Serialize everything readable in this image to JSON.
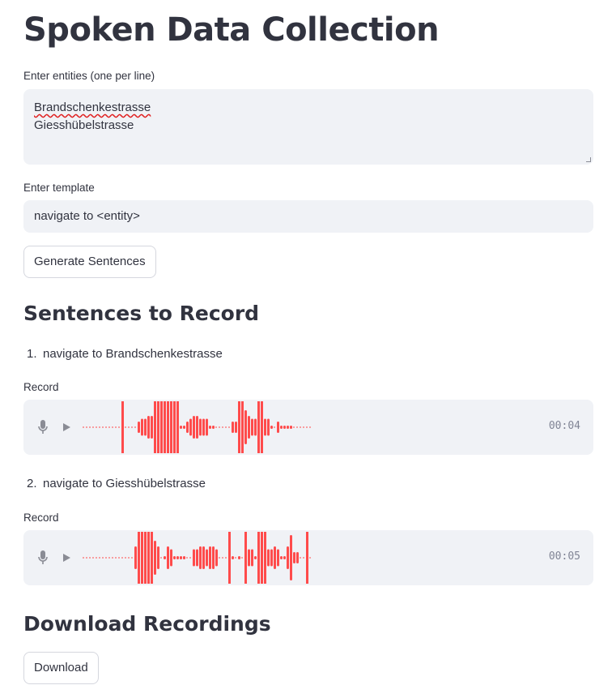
{
  "page": {
    "title": "Spoken Data Collection"
  },
  "entities": {
    "label": "Enter entities (one per line)",
    "lines": [
      "Brandschenkestrasse",
      "Giesshübelstrasse"
    ]
  },
  "template": {
    "label": "Enter template",
    "value": "navigate to <entity>"
  },
  "generate_button": "Generate Sentences",
  "sentences": {
    "title": "Sentences to Record",
    "items": [
      {
        "number": "1.",
        "text": "navigate to Brandschenkestrasse",
        "record_label": "Record",
        "duration": "00:04"
      },
      {
        "number": "2.",
        "text": "navigate to Giesshübelstrasse",
        "record_label": "Record",
        "duration": "00:05"
      }
    ]
  },
  "download": {
    "title": "Download Recordings",
    "button": "Download"
  },
  "colors": {
    "waveform": "#ff4b4b",
    "field_bg": "#f0f2f6",
    "text": "#31333f",
    "muted": "#808495"
  },
  "icons": [
    "microphone-icon",
    "play-icon"
  ]
}
